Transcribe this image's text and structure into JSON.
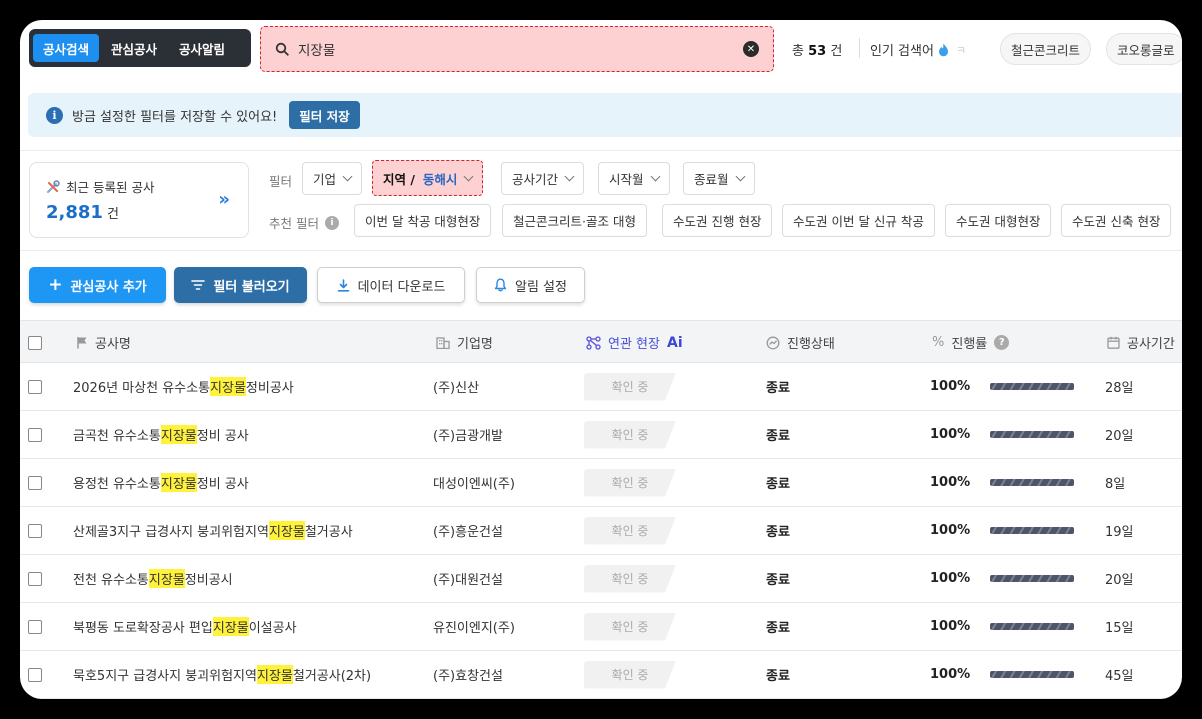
{
  "nav": {
    "tabs": [
      {
        "label": "공사검색",
        "active": true
      },
      {
        "label": "관심공사",
        "active": false
      },
      {
        "label": "공사알림",
        "active": false
      }
    ]
  },
  "search": {
    "value": "지장물",
    "clear_icon": "close-circle-icon"
  },
  "result": {
    "prefix": "총",
    "count": "53",
    "unit": "건"
  },
  "popular": {
    "label": "인기 검색어",
    "icon": "fire-icon",
    "faded": "",
    "chips": [
      "철근콘크리트",
      "코오롱글로"
    ]
  },
  "banner": {
    "text": "방금 설정한 필터를 저장할 수 있어요!",
    "button": "필터 저장"
  },
  "recent": {
    "title": "최근 등록된 공사",
    "count": "2,881",
    "unit": "건"
  },
  "filters": {
    "label": "필터",
    "company": "기업",
    "region_label": "지역 /",
    "region_value": "동해시",
    "period": "공사기간",
    "start_month": "시작월",
    "end_month": "종료월"
  },
  "recommended": {
    "label": "추천 필터",
    "chips": [
      "이번 달 착공 대형현장",
      "철근콘크리트·골조 대형",
      "수도권 진행 현장",
      "수도권 이번 달 신규 착공",
      "수도권 대형현장",
      "수도권 신축 현장"
    ]
  },
  "actions": {
    "add": "관심공사 추가",
    "load": "필터 불러오기",
    "download": "데이터 다운로드",
    "alert": "알림 설정"
  },
  "table": {
    "headers": {
      "name": "공사명",
      "company": "기업명",
      "related": "연관 현장",
      "ai": "Ai",
      "status": "진행상태",
      "progress": "진행률",
      "period": "공사기간"
    },
    "rows": [
      {
        "pre": "2026년 마상천 유수소통 ",
        "hl": "지장물",
        "post": "정비공사",
        "company": "(주)신산",
        "related": "확인 중",
        "status": "종료",
        "progress": "100%",
        "progress_value": 1.0,
        "period": "28일"
      },
      {
        "pre": "금곡천 유수소통 ",
        "hl": "지장물",
        "post": "정비 공사",
        "company": "(주)금광개발",
        "related": "확인 중",
        "status": "종료",
        "progress": "100%",
        "progress_value": 1.0,
        "period": "20일"
      },
      {
        "pre": "용정천 유수소통 ",
        "hl": "지장물",
        "post": "정비 공사",
        "company": "대성이엔씨(주)",
        "related": "확인 중",
        "status": "종료",
        "progress": "100%",
        "progress_value": 1.0,
        "period": "8일"
      },
      {
        "pre": "산제골3지구 급경사지 붕괴위험지역 ",
        "hl": "지장물",
        "post": "철거공사",
        "company": "(주)흥운건설",
        "related": "확인 중",
        "status": "종료",
        "progress": "100%",
        "progress_value": 1.0,
        "period": "19일"
      },
      {
        "pre": "전천 유수소통 ",
        "hl": "지장물",
        "post": "정비공시",
        "company": "(주)대원건설",
        "related": "확인 중",
        "status": "종료",
        "progress": "100%",
        "progress_value": 1.0,
        "period": "20일"
      },
      {
        "pre": "북평동 도로확장공사 편입 ",
        "hl": "지장물",
        "post": "이설공사",
        "company": "유진이엔지(주)",
        "related": "확인 중",
        "status": "종료",
        "progress": "100%",
        "progress_value": 1.0,
        "period": "15일"
      },
      {
        "pre": "묵호5지구 급경사지 붕괴위험지역 ",
        "hl": "지장물",
        "post": "철거공사(2차)",
        "company": "(주)효창건설",
        "related": "확인 중",
        "status": "종료",
        "progress": "100%",
        "progress_value": 1.0,
        "period": "45일"
      }
    ]
  },
  "colors": {
    "accent": "#1e96f3",
    "navy": "#2d6ea6",
    "highlight": "#fff23a",
    "focus_bg": "#fdd1d1",
    "focus_border": "#d2242a"
  }
}
